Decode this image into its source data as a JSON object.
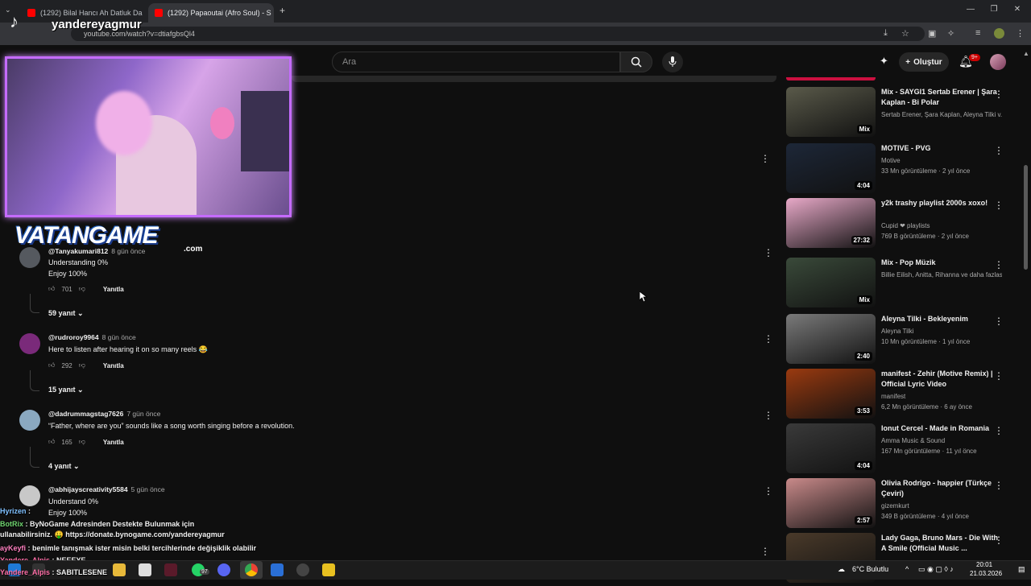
{
  "browser": {
    "tabs": [
      {
        "label": "(1292) Bilal Hancı Ah Datluk Da"
      },
      {
        "label": "(1292) Papaoutai (Afro Soul) - S"
      }
    ],
    "url": "youtube.com/watch?v=dtiafgbsQl4"
  },
  "youtube": {
    "search_placeholder": "Ara",
    "create_label": "Oluştur",
    "notif_count": "9+"
  },
  "overlay": {
    "streamer": "yandereyagmur",
    "sponsor": "VATANGAME",
    "sponsor_domain": ".com",
    "chat": [
      {
        "user": "Hyrizen",
        "text": ":"
      },
      {
        "user": "BotRix",
        "text": ": ByNoGame Adresinden Destekte Bulunmak için"
      },
      {
        "user": "",
        "text": "ullanabilirsiniz. 🤑 https://donate.bynogame.com/yandereyagmur"
      },
      {
        "user": "ayKeyfi",
        "text": ": benimle tanışmak ister misin belki tercihlerinde değişiklik olabilir"
      },
      {
        "user": "Yandere_Alpis",
        "text": ": NEEEYE"
      },
      {
        "user": "Yandere_Alpis",
        "text": ": SABITLESENE"
      }
    ]
  },
  "comments": [
    {
      "user": "@Tanyakumari812",
      "time": "8 gün önce",
      "lines": [
        "Understanding 0%",
        "Enjoy 100%"
      ],
      "likes": "701",
      "reply_label": "Yanıtla",
      "replies": "59 yanıt"
    },
    {
      "user": "@rudroroy9964",
      "time": "8 gün önce",
      "lines": [
        "Here to listen after hearing it on so many reels 😂"
      ],
      "likes": "292",
      "reply_label": "Yanıtla",
      "replies": "15 yanıt"
    },
    {
      "user": "@dadrummagstag7626",
      "time": "7 gün önce",
      "lines": [
        "“Father, where are you” sounds like a song worth singing before a revolution."
      ],
      "likes": "165",
      "reply_label": "Yanıtla",
      "replies": "4 yanıt"
    },
    {
      "user": "@abhijayscreativity5584",
      "time": "5 gün önce",
      "lines": [
        "Understand 0%",
        "Enjoy 100%"
      ],
      "likes": "",
      "reply_label": "Yanıtla",
      "replies": ""
    }
  ],
  "sidebar": [
    {
      "title": "Mix - SAYGI1 Sertab Erener | Şara Kaplan - Bi Polar",
      "channel": "Sertab Erener, Şara Kaplan, Aleyna Tilki v...",
      "meta": "",
      "badge": "Mix",
      "color": "#5a5a4a"
    },
    {
      "title": "MOTIVE - PVG",
      "channel": "Motive",
      "meta": "33 Mn görüntüleme · 2 yıl önce",
      "badge": "4:04",
      "color": "#1d2738"
    },
    {
      "title": "y2k trashy playlist 2000s xoxo!",
      "channel": "Cupid ❤ playlists",
      "meta": "769 B görüntüleme · 2 yıl önce",
      "badge": "27:32",
      "color": "#e8a9c8"
    },
    {
      "title": "Mix - Pop Müzik",
      "channel": "Billie Eilish, Anitta, Rihanna ve daha fazlası",
      "meta": "",
      "badge": "Mix",
      "color": "#3a4a3a"
    },
    {
      "title": "Aleyna Tilki - Bekleyenim",
      "channel": "Aleyna Tilki",
      "meta": "10 Mn görüntüleme · 1 yıl önce",
      "badge": "2:40",
      "color": "#7a7a7a"
    },
    {
      "title": "manifest - Zehir (Motive Remix) | Official Lyric Video",
      "channel": "manifest",
      "meta": "6,2 Mn görüntüleme · 6 ay önce",
      "badge": "3:53",
      "color": "#9a3a10"
    },
    {
      "title": "Ionut Cercel - Made in Romania",
      "channel": "Amma Music & Sound",
      "meta": "167 Mn görüntüleme · 11 yıl önce",
      "badge": "4:04",
      "color": "#3a3a3a"
    },
    {
      "title": "Olivia Rodrigo - happier (Türkçe Çeviri)",
      "channel": "gizemkurt",
      "meta": "349 B görüntüleme · 4 yıl önce",
      "badge": "2:57",
      "color": "#c98a8a"
    },
    {
      "title": "Lady Gaga, Bruno Mars - Die With A Smile (Official Music ...",
      "channel": "",
      "meta": "",
      "badge": "",
      "color": "#4a3a2a"
    }
  ],
  "taskbar": {
    "weather": "6°C  Bulutlu",
    "time": "20:01",
    "date": "21.03.2026",
    "whatsapp_count": "97"
  }
}
